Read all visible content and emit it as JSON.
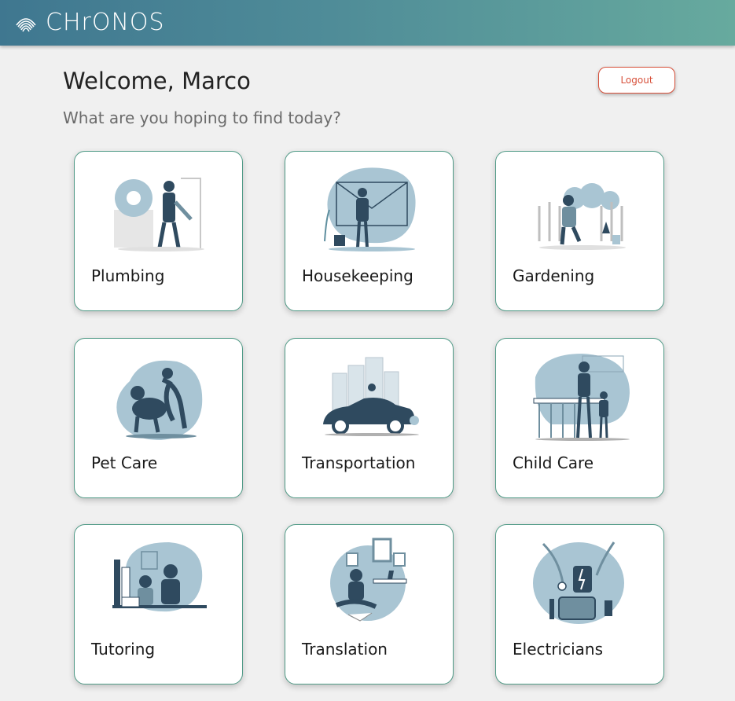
{
  "header": {
    "brand": "CHrONOS"
  },
  "greeting": {
    "welcome": "Welcome, Marco",
    "prompt": "What are you hoping to find today?"
  },
  "logout_label": "Logout",
  "colors": {
    "header_start": "#3f7790",
    "header_end": "#67aa9e",
    "accent_red": "#d7503a",
    "card_border": "#4f9a86",
    "illustration_blue": "#a9c5d3",
    "illustration_dark": "#2f4a5f"
  },
  "services": [
    {
      "label": "Plumbing",
      "icon": "plumbing-illustration"
    },
    {
      "label": "Housekeeping",
      "icon": "housekeeping-illustration"
    },
    {
      "label": "Gardening",
      "icon": "gardening-illustration"
    },
    {
      "label": "Pet Care",
      "icon": "pet-care-illustration"
    },
    {
      "label": "Transportation",
      "icon": "transportation-illustration"
    },
    {
      "label": "Child Care",
      "icon": "child-care-illustration"
    },
    {
      "label": "Tutoring",
      "icon": "tutoring-illustration"
    },
    {
      "label": "Translation",
      "icon": "translation-illustration"
    },
    {
      "label": "Electricians",
      "icon": "electricians-illustration"
    }
  ]
}
